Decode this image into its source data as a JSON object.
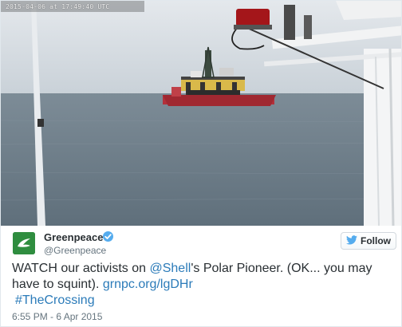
{
  "media": {
    "timestamp": "2015-04-06  at  17:49:40  UTC"
  },
  "author": {
    "display_name": "Greenpeace",
    "handle": "@Greenpeace",
    "verified": true,
    "avatar_icon": "greenpeace-logo-icon"
  },
  "follow_button": {
    "label": "Follow",
    "icon": "twitter-bird-icon"
  },
  "tweet": {
    "text_part1": "WATCH our activists on ",
    "mention": "@Shell",
    "text_part2": "'s Polar Pioneer. (OK... you may have to squint). ",
    "link": "grnpc.org/lgDHr",
    "hashtag": "#TheCrossing"
  },
  "footer": {
    "time": "6:55 PM - 6 Apr 2015"
  },
  "colors": {
    "link": "#2b7bb9",
    "verified": "#55acee",
    "sea": "#6f7f8b",
    "sky": "#d4dbe2"
  }
}
